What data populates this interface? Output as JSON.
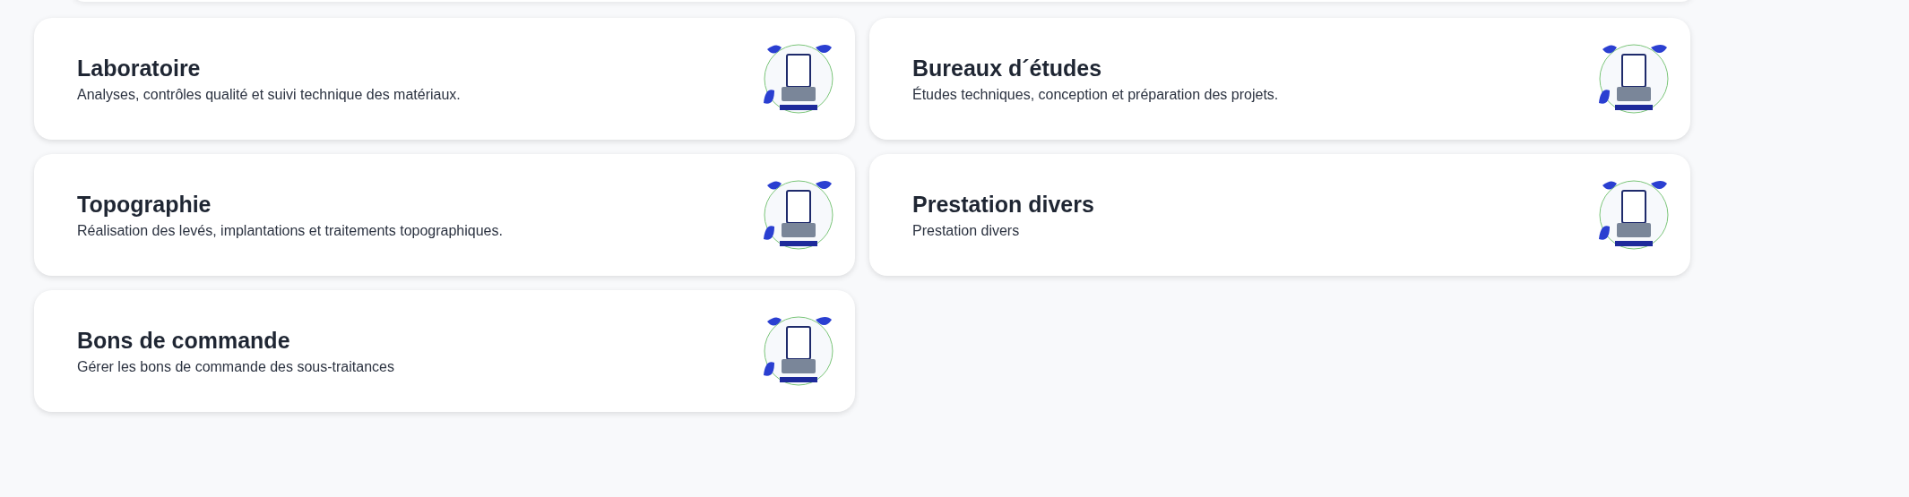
{
  "cards": [
    {
      "title": "Laboratoire",
      "description": "Analyses, contrôles qualité et suivi technique des matériaux."
    },
    {
      "title": "Bureaux d´études",
      "description": "Études techniques, conception et préparation des projets."
    },
    {
      "title": "Topographie",
      "description": "Réalisation des levés, implantations et traitements topographiques."
    },
    {
      "title": "Prestation divers",
      "description": "Prestation divers"
    },
    {
      "title": "Bons de commande",
      "description": "Gérer les bons de commande des sous-traitances"
    }
  ]
}
